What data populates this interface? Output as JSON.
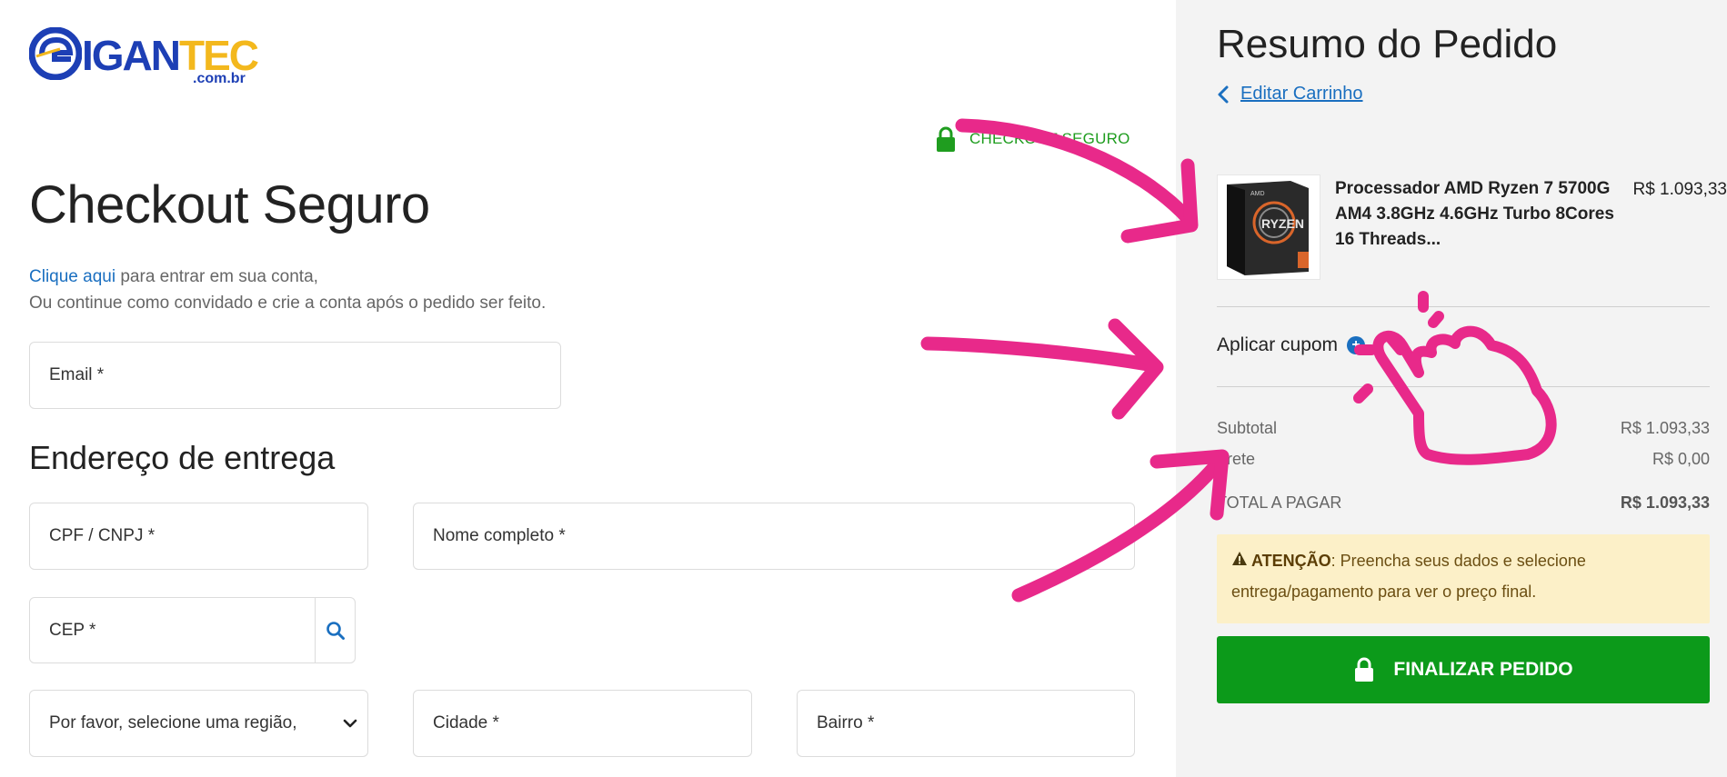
{
  "brand": {
    "logo_word_a": "IGAN",
    "logo_word_b": "TEC",
    "logo_domain": ".com.br",
    "primary_color": "#1d3fb5",
    "accent_color": "#f3b81d"
  },
  "header": {
    "secure_badge": "CHECKOUT SEGURO",
    "lock_icon": "lock-icon"
  },
  "checkout": {
    "title": "Checkout Seguro",
    "login_link": "Clique aqui",
    "login_text": " para entrar em sua conta,",
    "guest_text": "Ou continue como convidado e crie a conta após o pedido ser feito.",
    "email_placeholder": "Email *",
    "shipping_title": "Endereço de entrega",
    "cpf_placeholder": "CPF / CNPJ *",
    "name_placeholder": "Nome completo *",
    "cep_placeholder": "CEP *",
    "region_placeholder": "Por favor, selecione uma região,",
    "city_placeholder": "Cidade *",
    "district_placeholder": "Bairro *"
  },
  "summary": {
    "title": "Resumo do Pedido",
    "edit_cart": "Editar Carrinho",
    "product": {
      "name": "Processador AMD Ryzen 7 5700G AM4 3.8GHz 4.6GHz Turbo 8Cores 16 Threads...",
      "price": "R$ 1.093,33"
    },
    "coupon_label": "Aplicar cupom",
    "subtotal_label": "Subtotal",
    "subtotal_value": "R$ 1.093,33",
    "shipping_label": "Frete",
    "shipping_value": "R$ 0,00",
    "total_label": "TOTAL A PAGAR",
    "total_value": "R$ 1.093,33",
    "alert_strong": "ATENÇÃO",
    "alert_text": ": Preencha seus dados e selecione entrega/pagamento para ver o preço final.",
    "finalize_button": "FINALIZAR PEDIDO",
    "finalize_color": "#0c9a1a"
  },
  "annotation_color": "#e8298a"
}
